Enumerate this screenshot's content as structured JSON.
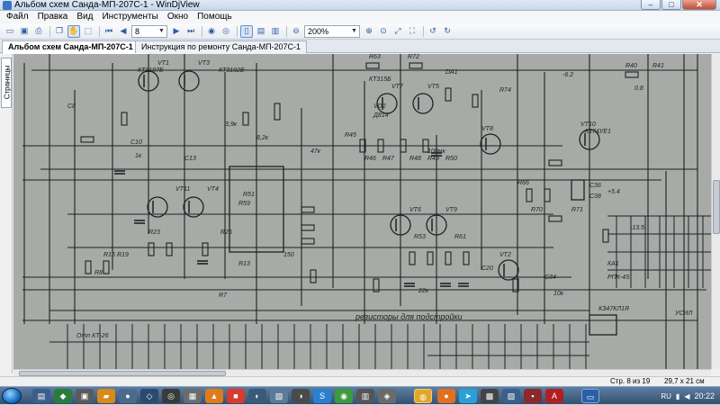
{
  "window": {
    "title": "Альбом схем Санда-МП-207С-1 - WinDjView",
    "min_label": "–",
    "max_label": "□",
    "close_label": "✕"
  },
  "menu": [
    "Файл",
    "Правка",
    "Вид",
    "Инструменты",
    "Окно",
    "Помощь"
  ],
  "toolbar": {
    "page_value": "8",
    "zoom_value": "200%"
  },
  "tabs": [
    {
      "label": "Альбом схем Санда-МП-207С-1",
      "active": true
    },
    {
      "label": "Инструкция по ремонту Санда-МП-207С-1",
      "active": false
    }
  ],
  "side_panel": {
    "label": "Страницы"
  },
  "schematic": {
    "labels": [
      "VT1",
      "VT3",
      "VT7",
      "VT5",
      "VT8",
      "VT10",
      "VT11",
      "VT4",
      "VT6",
      "VT9",
      "VT2",
      "КТ3107Е",
      "КТ3102Е",
      "КТ315Б",
      "DA1",
      "К174УЕ1",
      "R51",
      "R59",
      "R63",
      "R72",
      "R74",
      "R40",
      "R41",
      "R45",
      "R46",
      "R47",
      "R48",
      "R49",
      "R50",
      "R53",
      "R61",
      "R66",
      "R70",
      "R71",
      "R16",
      "R19",
      "R23",
      "R25",
      "R13",
      "R7",
      "R8",
      "C8",
      "C10",
      "C13",
      "C20",
      "C34",
      "C36",
      "C38",
      "КА1",
      "РПК-4S",
      "VD2",
      "Д814",
      "3,9к",
      "8,2к",
      "47к",
      "22к",
      "10к",
      "1к",
      "150",
      "100мк",
      "резисторы для подстройки",
      "Отп КТ-26",
      "КЗ47КЛ1Я",
      "УСИЛ",
      "-13.5",
      "0.8",
      "+5.4",
      "-6.2"
    ]
  },
  "status": {
    "page_info": "Стр. 8 из 19",
    "size_info": "29,7 x 21 см"
  },
  "taskbar": {
    "lang": "RU",
    "time": "20:22"
  }
}
